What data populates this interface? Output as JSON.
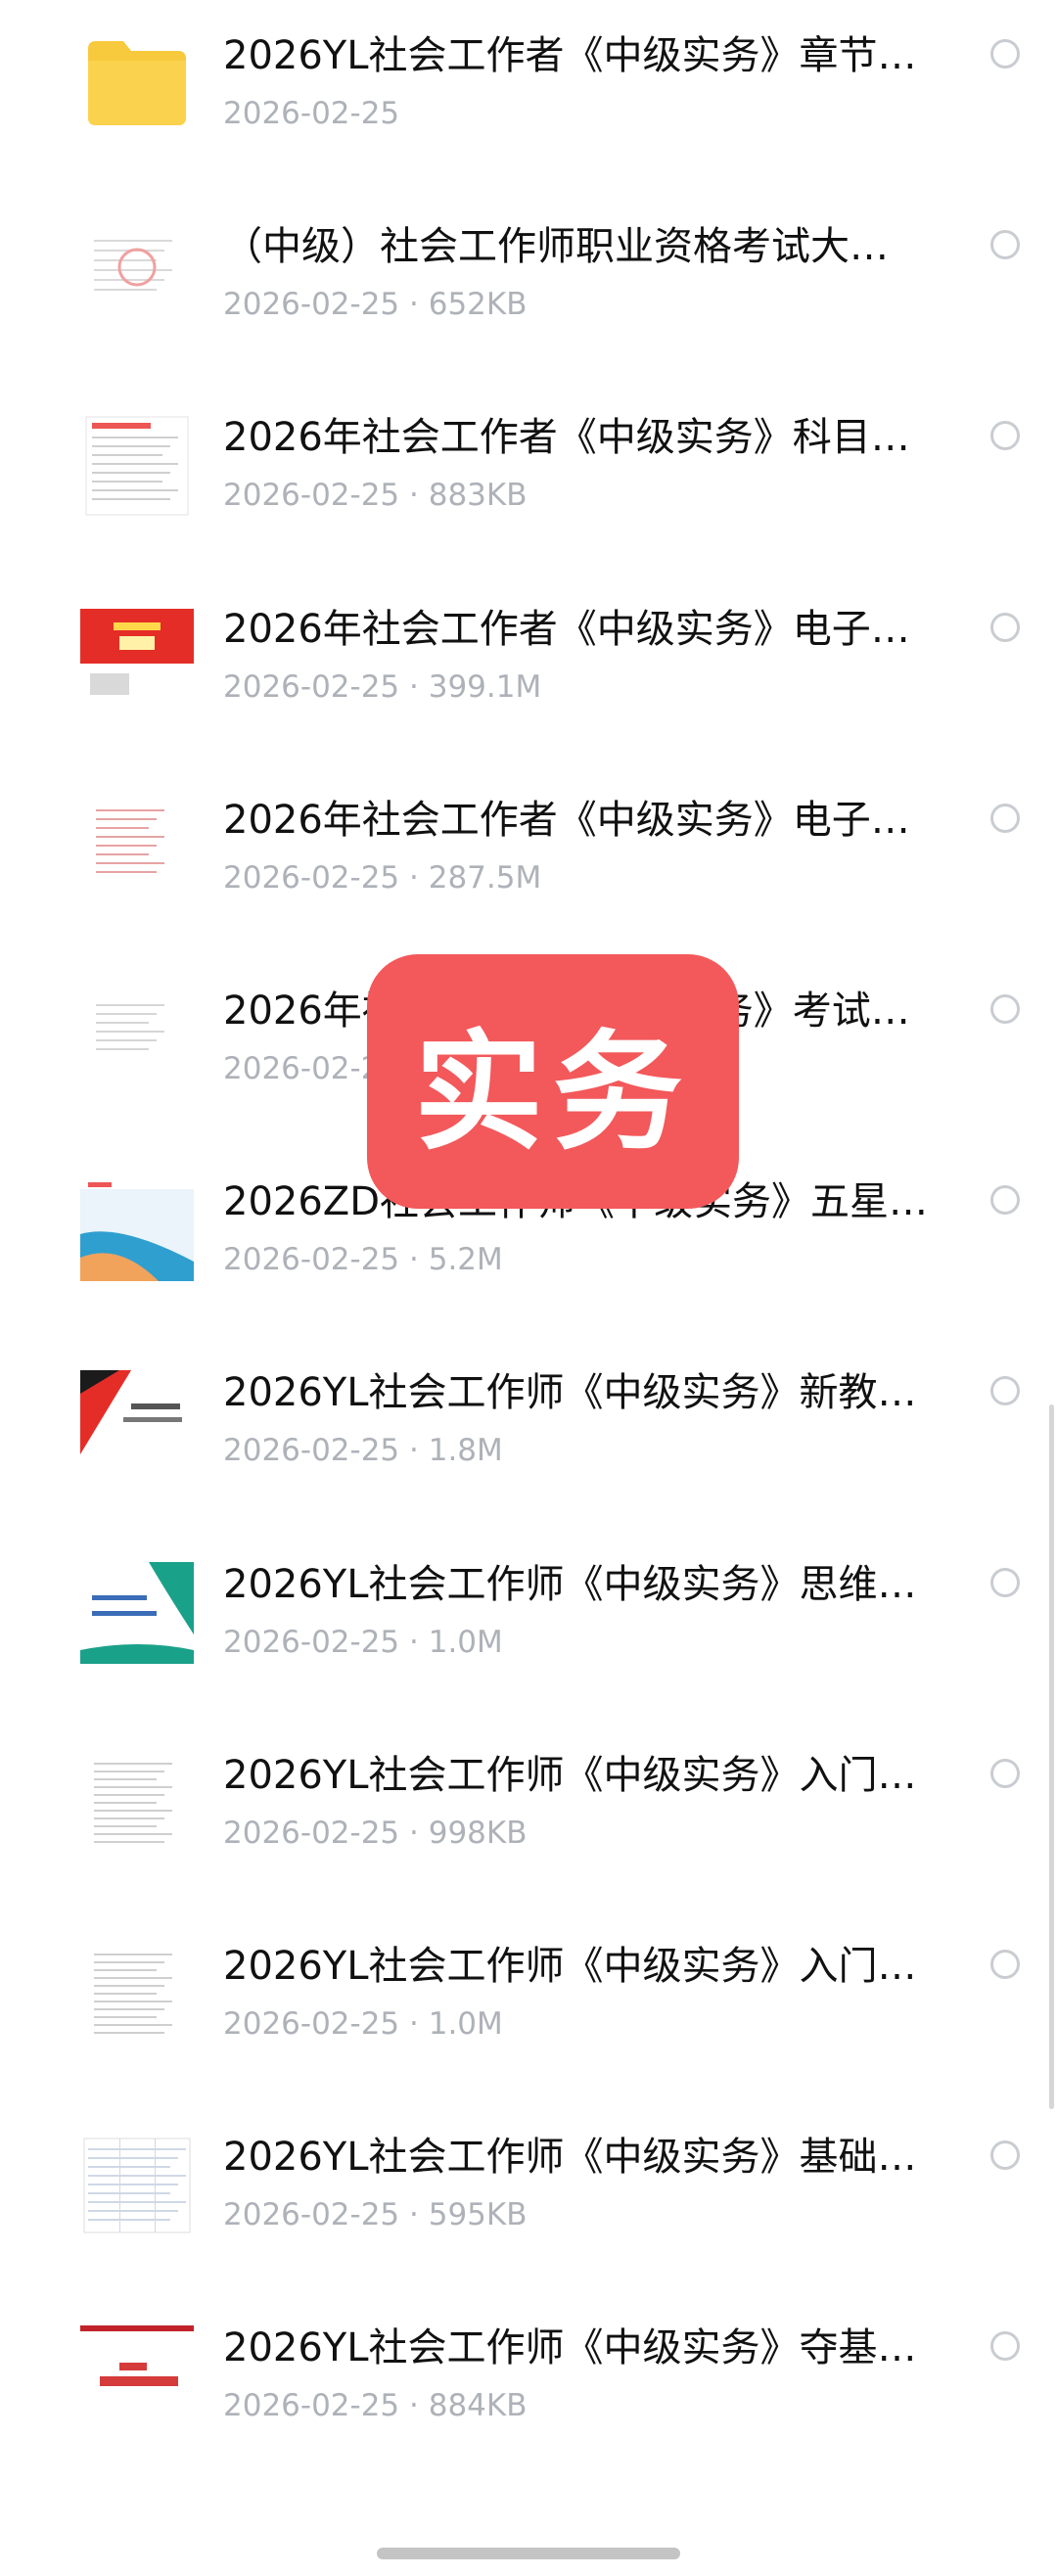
{
  "files": [
    {
      "kind": "folder",
      "icon": "folder-icon",
      "title": "2026YL社会工作者《中级实务》章节…",
      "meta": "2026-02-25"
    },
    {
      "kind": "doc-red-stamp",
      "icon": "document-thumbnail-icon",
      "title": "（中级）社会工作师职业资格考试大…",
      "meta": "2026-02-25 · 652KB"
    },
    {
      "kind": "doc-table",
      "icon": "document-thumbnail-icon",
      "title": "2026年社会工作者《中级实务》科目…",
      "meta": "2026-02-25 · 883KB"
    },
    {
      "kind": "doc-red-cover",
      "icon": "book-cover-thumbnail-icon",
      "title": "2026年社会工作者《中级实务》电子…",
      "meta": "2026-02-25 · 399.1M"
    },
    {
      "kind": "doc-toc",
      "icon": "document-thumbnail-icon",
      "title": "2026年社会工作者《中级实务》电子…",
      "meta": "2026-02-25 · 287.5M"
    },
    {
      "kind": "doc-plain",
      "icon": "document-thumbnail-icon",
      "title": "2026年社会工作者《中级实务》考试大纲…",
      "meta": "2026-02-25"
    },
    {
      "kind": "doc-blue-cover",
      "icon": "cover-thumbnail-icon",
      "title": "2026ZD社会工作师《中级实务》五星…",
      "meta": "2026-02-25 · 5.2M"
    },
    {
      "kind": "doc-red-black-cover",
      "icon": "cover-thumbnail-icon",
      "title": "2026YL社会工作师《中级实务》新教…",
      "meta": "2026-02-25 · 1.8M"
    },
    {
      "kind": "doc-teal-cover",
      "icon": "cover-thumbnail-icon",
      "title": "2026YL社会工作师《中级实务》思维…",
      "meta": "2026-02-25 · 1.0M"
    },
    {
      "kind": "doc-dense",
      "icon": "document-thumbnail-icon",
      "title": "2026YL社会工作师《中级实务》入门…",
      "meta": "2026-02-25 · 998KB"
    },
    {
      "kind": "doc-dense2",
      "icon": "document-thumbnail-icon",
      "title": "2026YL社会工作师《中级实务》入门…",
      "meta": "2026-02-25 · 1.0M"
    },
    {
      "kind": "doc-spreadsheet",
      "icon": "spreadsheet-thumbnail-icon",
      "title": "2026YL社会工作师《中级实务》基础…",
      "meta": "2026-02-25 · 595KB"
    },
    {
      "kind": "doc-red-title",
      "icon": "document-thumbnail-icon",
      "title": "2026YL社会工作师《中级实务》夺基…",
      "meta": "2026-02-25 · 884KB"
    }
  ],
  "overlay": {
    "text": "实务"
  },
  "colors": {
    "overlay_bg": "#f3585a",
    "folder": "#f7c93c",
    "meta_text": "#aeb2b8"
  }
}
